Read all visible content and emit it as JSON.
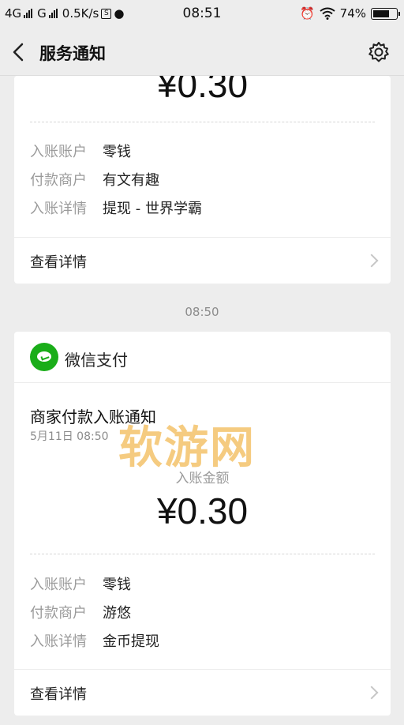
{
  "status_bar": {
    "network1": "4G",
    "network2": "G",
    "speed": "0.5K/s",
    "sim_badge": "S",
    "time": "08:51",
    "battery": "74%",
    "battery_level": 0.74
  },
  "nav": {
    "title": "服务通知",
    "icons": [
      "back-arrow-icon",
      "gear-icon"
    ]
  },
  "card1": {
    "amount": "¥0.30",
    "rows": [
      {
        "label": "入账账户",
        "value": "零钱"
      },
      {
        "label": "付款商户",
        "value": "有文有趣"
      },
      {
        "label": "入账详情",
        "value": "提现 - 世界学霸"
      }
    ],
    "details_label": "查看详情"
  },
  "timestamp": "08:50",
  "card2": {
    "source": "微信支付",
    "title": "商家付款入账通知",
    "date": "5月11日  08:50",
    "amount_label": "入账金额",
    "amount": "¥0.30",
    "rows": [
      {
        "label": "入账账户",
        "value": "零钱"
      },
      {
        "label": "付款商户",
        "value": "游悠"
      },
      {
        "label": "入账详情",
        "value": "金币提现"
      }
    ],
    "details_label": "查看详情"
  },
  "watermark": "软游网",
  "colors": {
    "wechat_green": "#1aad19",
    "watermark": "#f4c36a"
  }
}
